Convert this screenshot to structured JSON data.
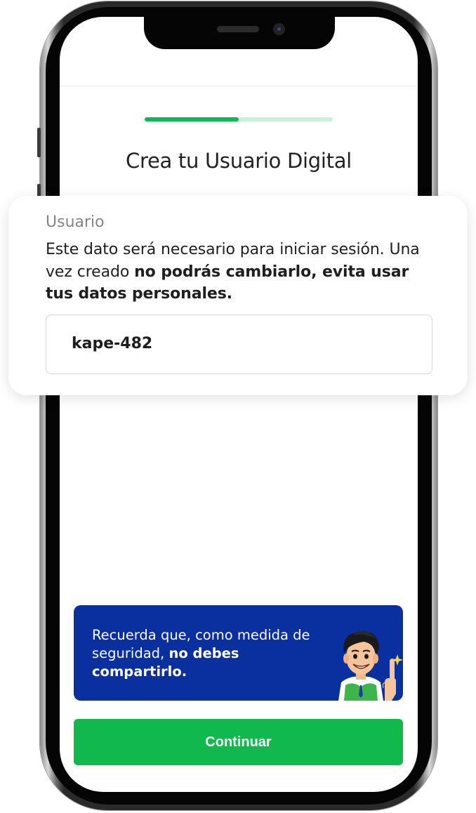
{
  "screen": {
    "title": "Crea tu Usuario Digital",
    "progress": 0.5,
    "colors": {
      "accent_green": "#10b84e",
      "progress_track": "#c9f0d8",
      "banner_blue": "#0a2f9e"
    }
  },
  "card": {
    "label": "Usuario",
    "desc_regular_1": "Este dato será necesario para iniciar sesión. Una vez creado ",
    "desc_bold": "no podrás cambiarlo, evita usar tus datos personales.",
    "username_value": "kape-482"
  },
  "banner": {
    "text_regular": "Recuerda que, como medida de seguridad, ",
    "text_bold": "no debes compartirlo.",
    "mascot_icon": "mascot-man-pointing-icon"
  },
  "footer": {
    "continue_label": "Continuar"
  }
}
